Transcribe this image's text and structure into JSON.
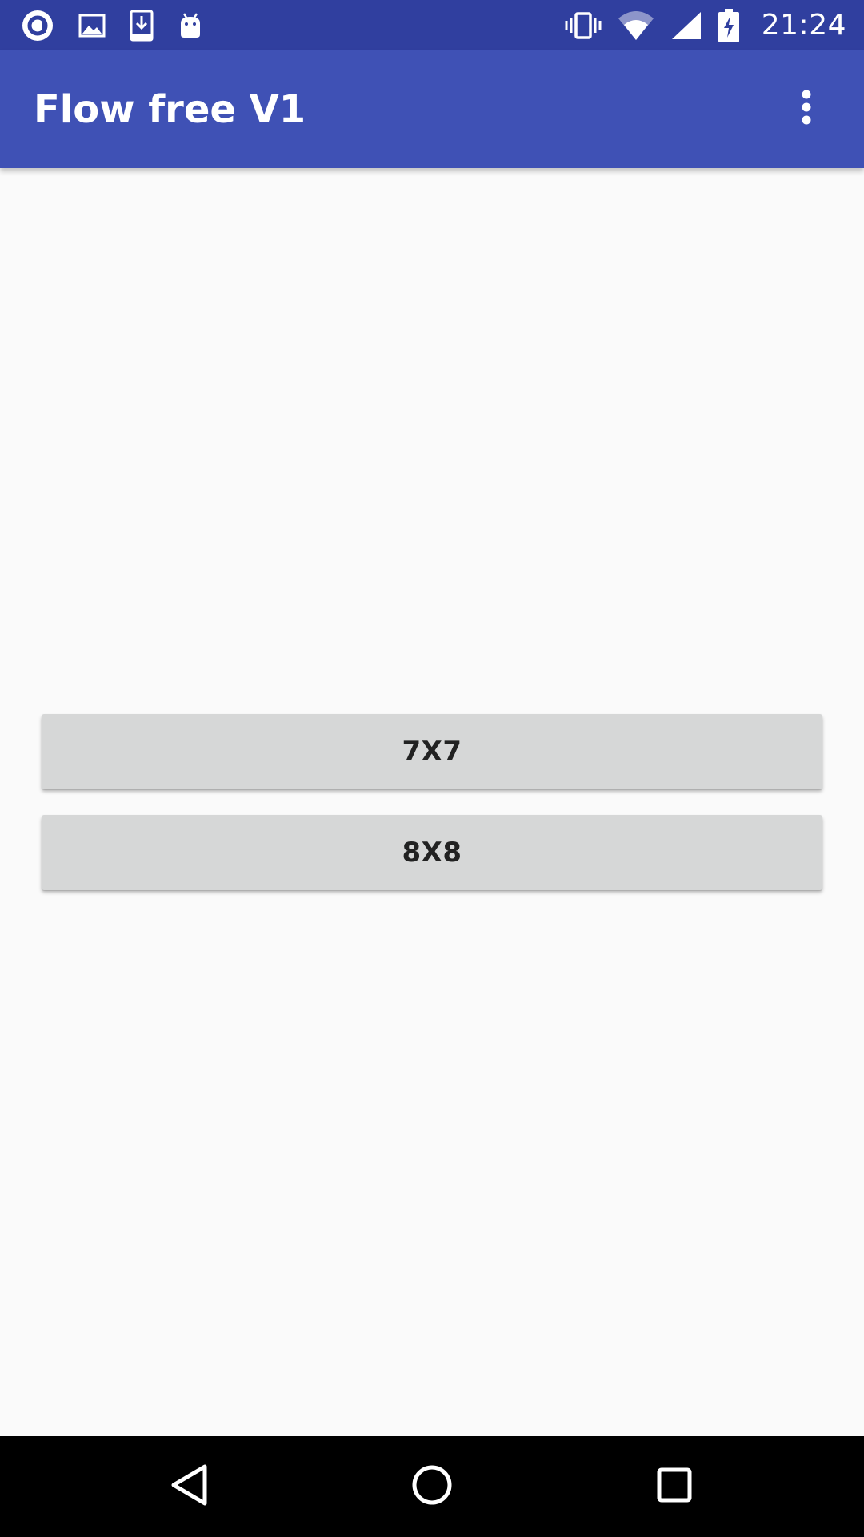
{
  "status_bar": {
    "time": "21:24",
    "background": "#303f9f",
    "left_icons": [
      "at-sign-icon",
      "image-icon",
      "download-icon",
      "android-icon"
    ],
    "right_icons": [
      "vibrate-icon",
      "wifi-icon",
      "signal-icon",
      "battery-charging-icon"
    ]
  },
  "app_bar": {
    "title": "Flow free V1",
    "background": "#3f51b5",
    "overflow_icon": "more-vert-icon"
  },
  "main": {
    "buttons": [
      {
        "label": "7X7"
      },
      {
        "label": "8X8"
      }
    ],
    "button_color": "#d6d7d7",
    "background": "#fafafa"
  },
  "nav_bar": {
    "icons": [
      "back-icon",
      "home-icon",
      "recents-icon"
    ],
    "background": "#000000"
  }
}
